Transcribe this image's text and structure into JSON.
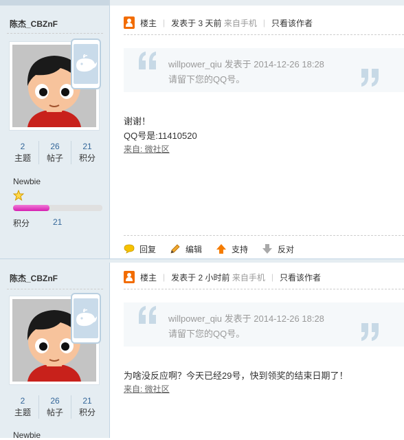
{
  "posts": [
    {
      "username": "陈杰_CBZnF",
      "stats": [
        {
          "num": "2",
          "label": "主题"
        },
        {
          "num": "26",
          "label": "帖子"
        },
        {
          "num": "21",
          "label": "积分"
        }
      ],
      "group": "Newbie",
      "credit_progress_pct": 41,
      "credit_label": "积分",
      "credit_value": "21",
      "meta": {
        "role": "楼主",
        "posted": "发表于 3 天前",
        "source": "来自手机",
        "only_author": "只看该作者"
      },
      "quote": {
        "line1": "willpower_qiu 发表于 2014-12-26 18:28",
        "line2": "请留下您的QQ号。"
      },
      "body_lines": [
        "谢谢！",
        "QQ号是:11410520"
      ],
      "source_link": "来自: 微社区",
      "actions": {
        "reply": "回复",
        "edit": "编辑",
        "support": "支持",
        "oppose": "反对"
      }
    },
    {
      "username": "陈杰_CBZnF",
      "stats": [
        {
          "num": "2",
          "label": "主题"
        },
        {
          "num": "26",
          "label": "帖子"
        },
        {
          "num": "21",
          "label": "积分"
        }
      ],
      "group": "Newbie",
      "meta": {
        "role": "楼主",
        "posted": "发表于 2 小时前",
        "source": "来自手机",
        "only_author": "只看该作者"
      },
      "quote": {
        "line1": "willpower_qiu 发表于 2014-12-26 18:28",
        "line2": "请留下您的QQ号。"
      },
      "body_lines": [
        "为啥没反应啊？今天已经29号，快到领奖的结束日期了！"
      ],
      "source_link": "来自: 微社区"
    }
  ],
  "colors": {
    "sidebar_bg": "#e5edf2",
    "link_blue": "#336699",
    "progress_pink": "#e040c0",
    "quote_mark": "#c7d9e6"
  }
}
